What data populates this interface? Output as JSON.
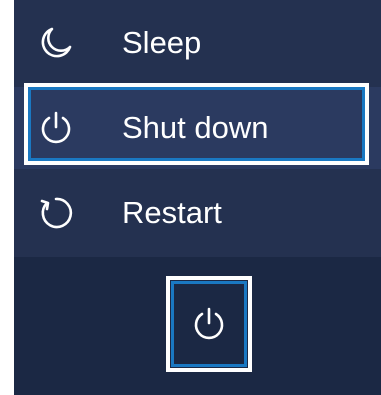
{
  "power_menu": {
    "items": [
      {
        "label": "Sleep",
        "icon": "moon-icon"
      },
      {
        "label": "Shut down",
        "icon": "power-icon",
        "selected": true
      },
      {
        "label": "Restart",
        "icon": "restart-icon"
      }
    ]
  },
  "power_button": {
    "icon": "power-icon"
  },
  "colors": {
    "menu_background": "#243150",
    "taskbar_background": "#1b2844",
    "highlight_outer": "#ffffff",
    "highlight_inner": "#1a78c2",
    "text": "#ffffff"
  }
}
